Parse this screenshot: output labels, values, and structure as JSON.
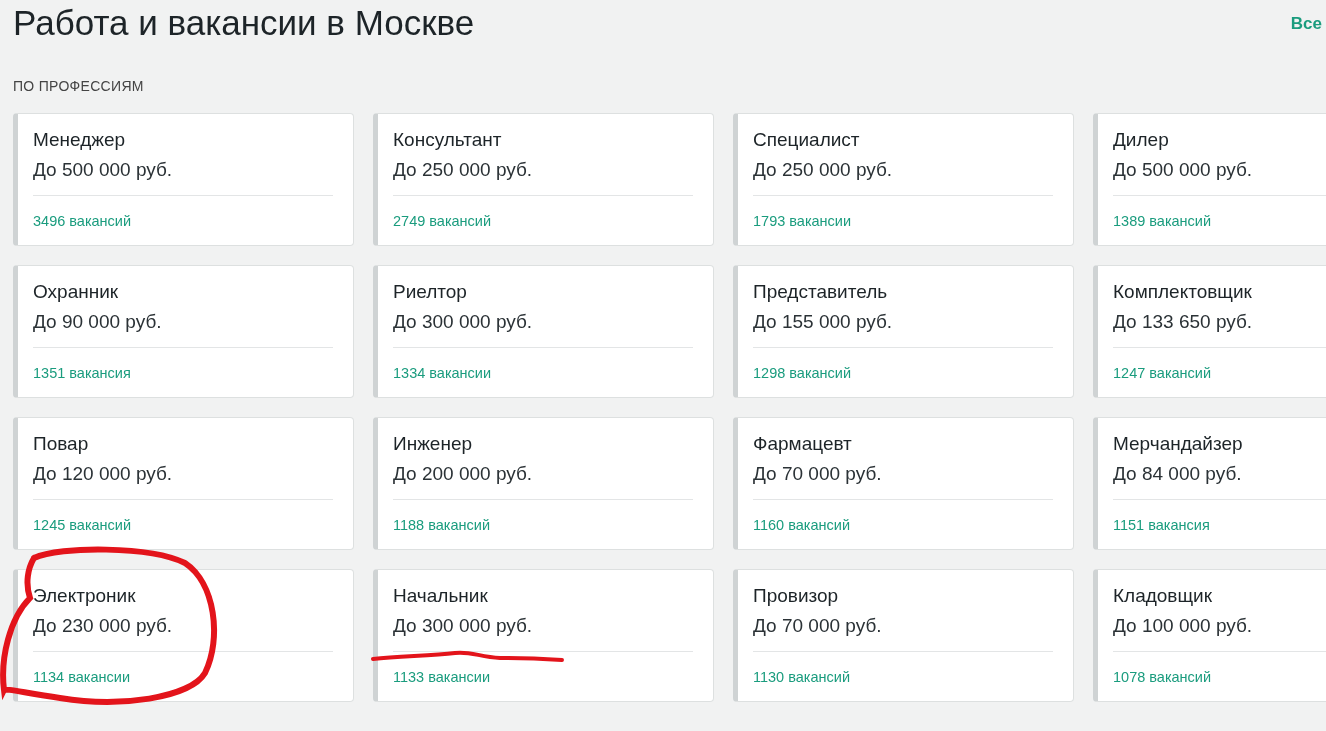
{
  "title": "Работа и вакансии в Москве",
  "all_link": "Все",
  "section": "ПО ПРОФЕССИЯМ",
  "cards": [
    {
      "name": "Менеджер",
      "salary": "До 500 000 руб.",
      "count": "3496 вакансий"
    },
    {
      "name": "Консультант",
      "salary": "До 250 000 руб.",
      "count": "2749 вакансий"
    },
    {
      "name": "Специалист",
      "salary": "До 250 000 руб.",
      "count": "1793 вакансии"
    },
    {
      "name": "Дилер",
      "salary": "До 500 000 руб.",
      "count": "1389 вакансий"
    },
    {
      "name": "Охранник",
      "salary": "До 90 000 руб.",
      "count": "1351 вакансия"
    },
    {
      "name": "Риелтор",
      "salary": "До 300 000 руб.",
      "count": "1334 вакансии"
    },
    {
      "name": "Представитель",
      "salary": "До 155 000 руб.",
      "count": "1298 вакансий"
    },
    {
      "name": "Комплектовщик",
      "salary": "До 133 650 руб.",
      "count": "1247 вакансий"
    },
    {
      "name": "Повар",
      "salary": "До 120 000 руб.",
      "count": "1245 вакансий"
    },
    {
      "name": "Инженер",
      "salary": "До 200 000 руб.",
      "count": "1188 вакансий"
    },
    {
      "name": "Фармацевт",
      "salary": "До 70 000 руб.",
      "count": "1160 вакансий"
    },
    {
      "name": "Мерчандайзер",
      "salary": "До 84 000 руб.",
      "count": "1151 вакансия"
    },
    {
      "name": "Электроник",
      "salary": "До 230 000 руб.",
      "count": "1134 вакансии",
      "circled": true
    },
    {
      "name": "Начальник",
      "salary": "До 300 000 руб.",
      "count": "1133 вакансии",
      "underlined": true
    },
    {
      "name": "Провизор",
      "salary": "До 70 000 руб.",
      "count": "1130 вакансий"
    },
    {
      "name": "Кладовщик",
      "salary": "До 100 000 руб.",
      "count": "1078 вакансий"
    }
  ]
}
